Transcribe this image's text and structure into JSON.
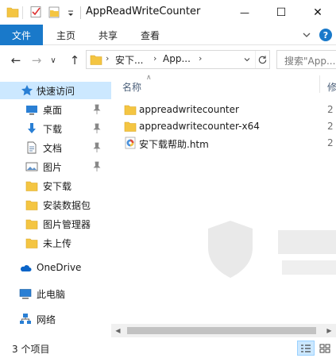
{
  "window": {
    "title": "AppReadWriteCounter",
    "minimize_glyph": "—",
    "maximize_glyph": "☐",
    "close_glyph": "✕"
  },
  "ribbon": {
    "file_tab": "文件",
    "tabs": [
      "主页",
      "共享",
      "查看"
    ],
    "help_glyph": "?"
  },
  "nav": {
    "back_glyph": "←",
    "forward_glyph": "→",
    "recent_glyph": "∨",
    "up_glyph": "↑",
    "breadcrumbs": [
      "安下...",
      "App..."
    ],
    "crumb_separator": "›",
    "search_placeholder": "搜索\"App..."
  },
  "sidebar": {
    "items": [
      {
        "label": "快速访问",
        "icon": "star-icon",
        "selected": true,
        "pinned": false
      },
      {
        "label": "桌面",
        "icon": "desktop-icon",
        "selected": false,
        "pinned": true
      },
      {
        "label": "下载",
        "icon": "download-icon",
        "selected": false,
        "pinned": true
      },
      {
        "label": "文档",
        "icon": "document-icon",
        "selected": false,
        "pinned": true
      },
      {
        "label": "图片",
        "icon": "picture-icon",
        "selected": false,
        "pinned": true
      },
      {
        "label": "安下载",
        "icon": "folder-icon",
        "selected": false,
        "pinned": false
      },
      {
        "label": "安装数据包",
        "icon": "folder-icon",
        "selected": false,
        "pinned": false
      },
      {
        "label": "图片管理器",
        "icon": "folder-icon",
        "selected": false,
        "pinned": false
      },
      {
        "label": "未上传",
        "icon": "folder-icon",
        "selected": false,
        "pinned": false
      },
      {
        "label": "OneDrive",
        "icon": "cloud-icon",
        "selected": false,
        "pinned": false
      },
      {
        "label": "此电脑",
        "icon": "computer-icon",
        "selected": false,
        "pinned": false
      },
      {
        "label": "网络",
        "icon": "network-icon",
        "selected": false,
        "pinned": false
      }
    ]
  },
  "main": {
    "columns": {
      "name": "名称",
      "modified": "修",
      "sort_glyph": "∧"
    },
    "files": [
      {
        "name": "appreadwritecounter",
        "type": "folder",
        "date": "2"
      },
      {
        "name": "appreadwritecounter-x64",
        "type": "folder",
        "date": "2"
      },
      {
        "name": "安下载帮助.htm",
        "type": "htm",
        "date": "2"
      }
    ]
  },
  "statusbar": {
    "item_count": "3 个项目"
  },
  "colors": {
    "accent": "#1979ca",
    "selection": "#cce8ff",
    "folder": "#f4c542"
  }
}
